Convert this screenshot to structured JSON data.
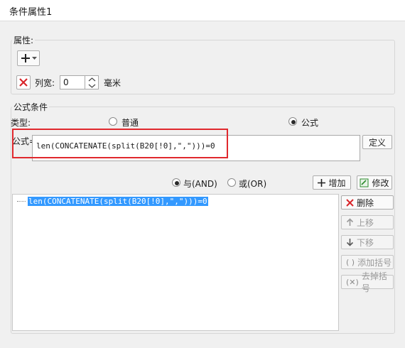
{
  "window": {
    "title": "条件属性1"
  },
  "attributes": {
    "label": "属性:",
    "column_width_label": "列宽:",
    "column_width_value": "0",
    "unit_label": "毫米"
  },
  "formula": {
    "group_label": "公式条件",
    "type_label": "类型:",
    "option_normal": "普通",
    "option_formula": "公式",
    "formula_label": "公式=",
    "formula_value": "len(CONCATENATE(split(B20[!0],\",\")))=0",
    "define_button": "定义",
    "and_label": "与(AND)",
    "or_label": "或(OR)",
    "add_button": "增加",
    "modify_button": "修改"
  },
  "condition_list": {
    "items": [
      "len(CONCATENATE(split(B20[!0],\",\")))=0"
    ]
  },
  "side_buttons": {
    "delete": "删除",
    "move_up": "上移",
    "move_down": "下移",
    "add_bracket": "添加括号",
    "remove_bracket": "去掉括号"
  },
  "colors": {
    "highlight_box": "#e0282d",
    "selection": "#3399ff",
    "delete_icon": "#d9252a",
    "add_icon": "#2b8a2b"
  }
}
